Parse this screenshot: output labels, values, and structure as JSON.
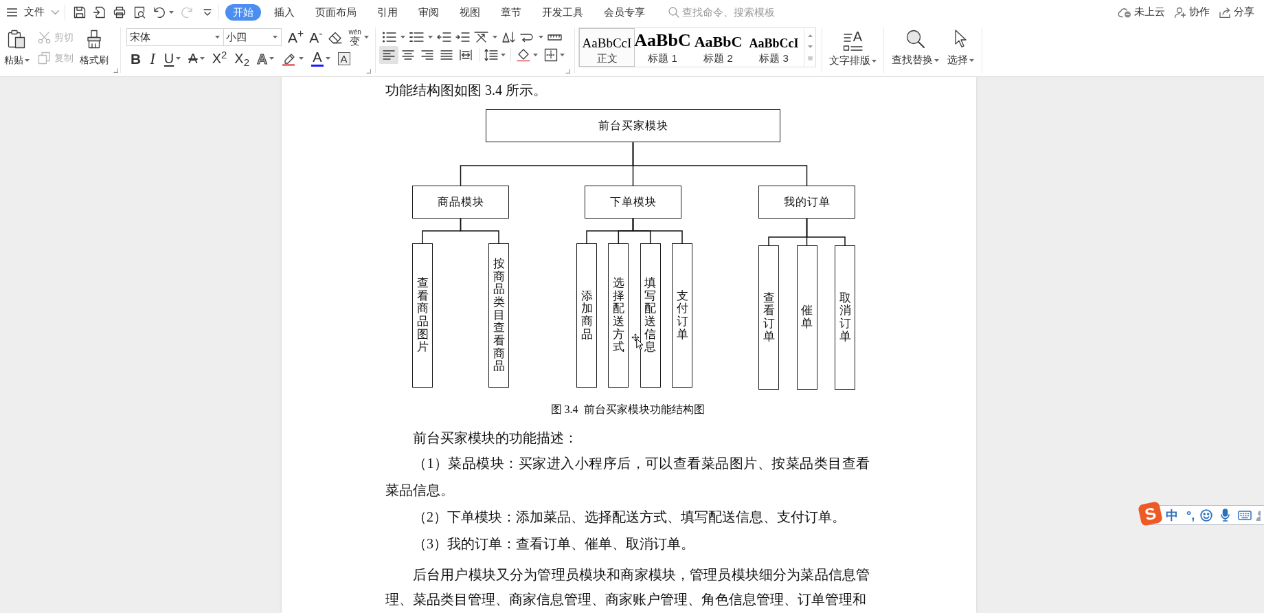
{
  "title_bar": {
    "menu_label": "文件"
  },
  "quick_access": [
    {
      "kind": "save",
      "disabled": false,
      "dropdown": false
    },
    {
      "kind": "export",
      "disabled": false,
      "dropdown": false
    },
    {
      "kind": "print",
      "disabled": false,
      "dropdown": false
    },
    {
      "kind": "preview",
      "disabled": false,
      "dropdown": false
    },
    {
      "kind": "undo",
      "disabled": false,
      "dropdown": true
    },
    {
      "kind": "redo",
      "disabled": true,
      "dropdown": false
    }
  ],
  "tabs": [
    {
      "label": "开始",
      "selected": true
    },
    {
      "label": "插入",
      "selected": false
    },
    {
      "label": "页面布局",
      "selected": false
    },
    {
      "label": "引用",
      "selected": false
    },
    {
      "label": "审阅",
      "selected": false
    },
    {
      "label": "视图",
      "selected": false
    },
    {
      "label": "章节",
      "selected": false
    },
    {
      "label": "开发工具",
      "selected": false
    },
    {
      "label": "会员专享",
      "selected": false
    }
  ],
  "command_search": {
    "placeholder": "查找命令、搜索模板"
  },
  "account_actions": [
    {
      "kind": "cloud",
      "label": "未上云"
    },
    {
      "kind": "collaborate",
      "label": "协作"
    },
    {
      "kind": "share",
      "label": "分享"
    }
  ],
  "ribbon": {
    "clipboard": [
      {
        "kind": "paste",
        "label": "粘贴",
        "disabled": false,
        "dropdown": true
      },
      {
        "kind": "cut",
        "label": "剪切",
        "disabled": true,
        "dropdown": false
      },
      {
        "kind": "copy",
        "label": "复制",
        "disabled": true,
        "dropdown": false
      },
      {
        "kind": "format_painter",
        "label": "格式刷",
        "disabled": false,
        "dropdown": false
      }
    ],
    "font_name": "宋体",
    "font_size": "小四",
    "font_tools": [
      {
        "kind": "grow",
        "glyph": "A$^{+}$",
        "dropdown": false
      },
      {
        "kind": "shrink",
        "glyph": "A$^{-}$",
        "dropdown": false
      },
      {
        "kind": "clear",
        "dropdown": false
      },
      {
        "kind": "phonetic",
        "glyph": "变",
        "ruby": "wén",
        "dropdown": true
      }
    ],
    "format_buttons": [
      {
        "kind": "bold",
        "glyph": "B",
        "dropdown": false
      },
      {
        "kind": "italic",
        "glyph": "I",
        "dropdown": false
      },
      {
        "kind": "underline",
        "glyph": "U",
        "dropdown": true
      },
      {
        "kind": "strikethrough",
        "glyph": "A",
        "dropdown": true
      },
      {
        "kind": "superscript",
        "glyph": "X$^{2}$",
        "dropdown": false
      },
      {
        "kind": "subscript",
        "glyph": "X$_{2}$",
        "dropdown": false
      },
      {
        "kind": "outline",
        "glyph": "A",
        "dropdown": true
      },
      {
        "kind": "highlight",
        "dropdown": true
      },
      {
        "kind": "font_color",
        "glyph": "A",
        "dropdown": true
      },
      {
        "kind": "char_border",
        "glyph": "A",
        "dropdown": false
      }
    ],
    "alignment": [
      {
        "kind": "left",
        "selected": true
      },
      {
        "kind": "center",
        "selected": false
      },
      {
        "kind": "right",
        "selected": false
      },
      {
        "kind": "justify",
        "selected": false
      },
      {
        "kind": "distributed",
        "selected": false
      }
    ],
    "styles": [
      {
        "kind": "body",
        "preview": "AaBbCcI",
        "label": "正文",
        "selected": true
      },
      {
        "kind": "heading1",
        "preview": "AaBbC",
        "label": "标题 1",
        "selected": false
      },
      {
        "kind": "heading2",
        "preview": "AaBbC",
        "label": "标题 2",
        "selected": false
      },
      {
        "kind": "heading3",
        "preview": "AaBbCcI",
        "label": "标题 3",
        "selected": false
      }
    ],
    "tools": [
      {
        "kind": "text_layout",
        "label": "文字排版",
        "glyph": "A"
      },
      {
        "kind": "find_replace",
        "label": "查找替换"
      },
      {
        "kind": "select",
        "label": "选择"
      }
    ]
  },
  "document": {
    "blocks": [
      {
        "kind": "continuation",
        "text": "功能结构图如图 3.4 所示。"
      },
      {
        "kind": "figure",
        "tree": {
          "label": "前台买家模块",
          "children": [
            {
              "label": "商品模块",
              "children": [
                {
                  "label": "查看商品图片"
                },
                {
                  "label": "按商品类目查看商品"
                }
              ]
            },
            {
              "label": "下单模块",
              "children": [
                {
                  "label": "添加商品"
                },
                {
                  "label": "选择配送方式"
                },
                {
                  "label": "填写配送信息"
                },
                {
                  "label": "支付订单"
                }
              ]
            },
            {
              "label": "我的订单",
              "children": [
                {
                  "label": "查看订单"
                },
                {
                  "label": "催单"
                },
                {
                  "label": "取消订单"
                }
              ]
            }
          ]
        },
        "caption": "图 3.4  前台买家模块功能结构图"
      },
      {
        "kind": "paragraph",
        "text": "前台买家模块的功能描述："
      },
      {
        "kind": "list_item",
        "text": "（1）菜品模块：买家进入小程序后，可以查看菜品图片、按菜品类目查看菜品信息。"
      },
      {
        "kind": "list_item",
        "text": "（2）下单模块：添加菜品、选择配送方式、填写配送信息、支付订单。"
      },
      {
        "kind": "list_item",
        "text": "（3）我的订单：查看订单、催单、取消订单。"
      },
      {
        "kind": "paragraph",
        "text": "后台用户模块又分为管理员模块和商家模块，管理员模块细分为菜品信息管理、菜品类目管理、商家信息管理、商家账户管理、角色信息管理、订单管理和"
      }
    ]
  },
  "ime_bar": {
    "logo": "S",
    "mode": "中",
    "punctuation": "°,"
  }
}
